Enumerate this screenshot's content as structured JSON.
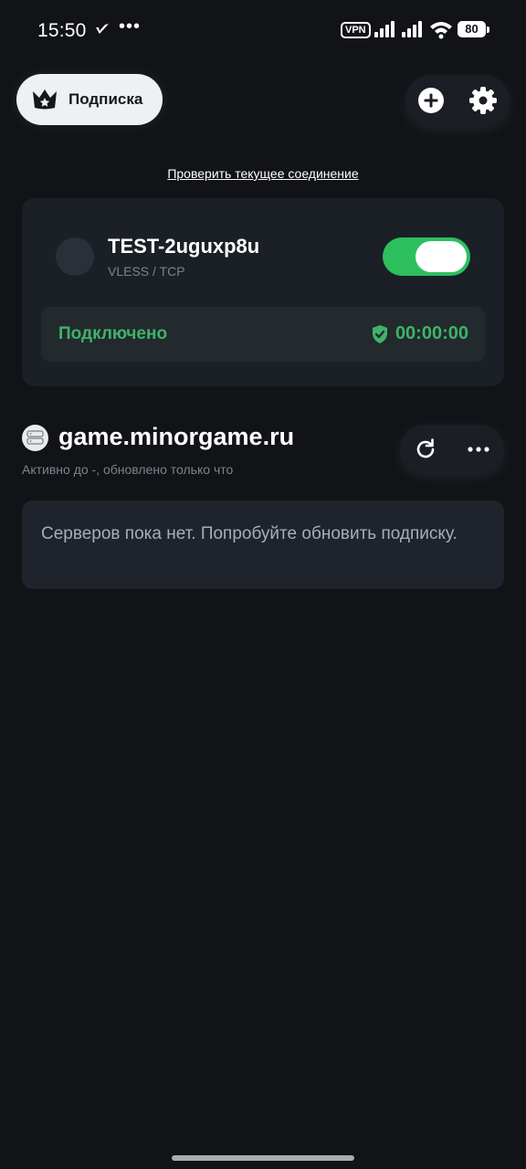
{
  "status_bar": {
    "time": "15:50",
    "more": "•••",
    "vpn": "VPN",
    "battery": "80"
  },
  "header": {
    "subscription_label": "Подписка",
    "icons": {
      "subscription": "crown-icon",
      "add": "plus-circle-icon",
      "settings": "gear-icon"
    }
  },
  "check_connection": "Проверить текущее соединение",
  "connection": {
    "server_name": "TEST-2uguxp8u",
    "protocol": "VLESS / TCP",
    "enabled": true,
    "status": "Подключено",
    "duration": "00:00:00",
    "accent": "#3fb36b",
    "toggle_color": "#2dbf5e"
  },
  "subscription": {
    "title": "game.minorgame.ru",
    "meta": "Активно до -, обновлено только что",
    "icons": {
      "refresh": "refresh-icon",
      "more": "more-horizontal-icon"
    },
    "empty_message": "Серверов пока нет. Попробуйте обновить подписку."
  }
}
